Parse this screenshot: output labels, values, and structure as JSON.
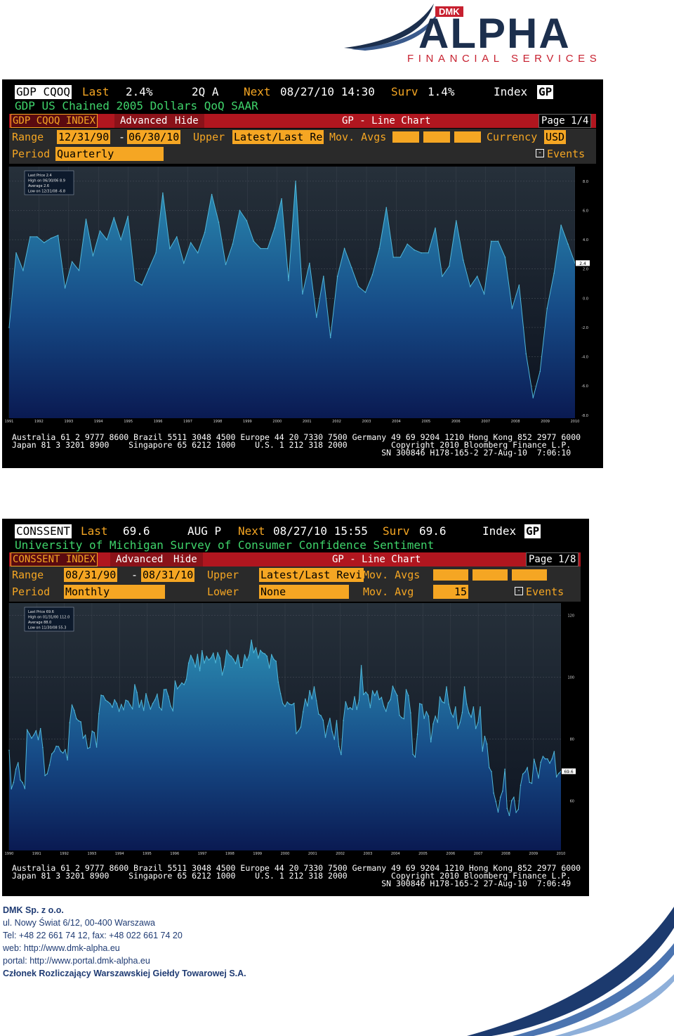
{
  "brand": {
    "badge": "DMK",
    "name": "ALPHA",
    "tagline": "FINANCIAL SERVICES",
    "colors": {
      "navy": "#1c2f4d",
      "red": "#c7202f",
      "terminal_orange": "#f5a623",
      "menu_red": "#b0161f"
    }
  },
  "terminals": [
    {
      "ticker": "GDP CQOQ",
      "last_label": "Last",
      "last_value": "2.4%",
      "period_code": "2Q A",
      "next_label": "Next",
      "next_datetime": "08/27/10 14:30",
      "surv_label": "Surv",
      "surv_value": "1.4%",
      "index_label": "Index",
      "gp_label": "GP",
      "description": "GDP US Chained 2005 Dollars QoQ SAAR",
      "menu": {
        "security": "GDP CQOQ INDEX",
        "advanced": "Advanced",
        "hide": "Hide",
        "title": "GP - Line Chart",
        "page": "Page 1/4"
      },
      "options": {
        "range_label": "Range",
        "range_start": "12/31/90",
        "dash": "-",
        "range_end": "06/30/10",
        "upper_label": "Upper",
        "upper_value": "Latest/Last Re",
        "movavg_label": "Mov. Avgs",
        "currency_label": "Currency",
        "currency_value": "USD",
        "period_label": "Period",
        "period_value": "Quarterly",
        "events_label": "Events"
      },
      "legend": [
        "Last Price  2.4",
        "High on 06/30/06  8.9",
        "Average  2.6",
        "Low on 12/31/08  -6.8"
      ],
      "footer": [
        "Australia 61 2 9777 8600 Brazil 5511 3048 4500 Europe 44 20 7330 7500 Germany 49 69 9204 1210 Hong Kong 852 2977 6000",
        "Japan 81 3 3201 8900    Singapore 65 6212 1000    U.S. 1 212 318 2000         Copyright 2010 Bloomberg Finance L.P.",
        "                                                                            SN 300846 H178-165-2 27-Aug-10  7:06:10"
      ]
    },
    {
      "ticker": "CONSSENT",
      "last_label": "Last",
      "last_value": "69.6",
      "period_code": "AUG P",
      "next_label": "Next",
      "next_datetime": "08/27/10 15:55",
      "surv_label": "Surv",
      "surv_value": "69.6",
      "index_label": "Index",
      "gp_label": "GP",
      "description": "University of Michigan Survey of Consumer Confidence Sentiment",
      "menu": {
        "security": "CONSSENT INDEX",
        "advanced": "Advanced",
        "hide": "Hide",
        "title": "GP - Line Chart",
        "page": "Page 1/8"
      },
      "options": {
        "range_label": "Range",
        "range_start": "08/31/90",
        "dash": "-",
        "range_end": "08/31/10",
        "upper_label": "Upper",
        "upper_value": "Latest/Last Revi",
        "movavg_label": "Mov. Avgs",
        "period_label": "Period",
        "period_value": "Monthly",
        "lower_label": "Lower",
        "lower_value": "None",
        "movavg2_label": "Mov. Avg",
        "movavg2_value": "15",
        "events_label": "Events"
      },
      "legend": [
        "Last Price  69.6",
        "High on 01/31/00  112.0",
        "Average  88.0",
        "Low on 11/30/08  55.3"
      ],
      "footer": [
        "Australia 61 2 9777 8600 Brazil 5511 3048 4500 Europe 44 20 7330 7500 Germany 49 69 9204 1210 Hong Kong 852 2977 6000",
        "Japan 81 3 3201 8900    Singapore 65 6212 1000    U.S. 1 212 318 2000         Copyright 2010 Bloomberg Finance L.P.",
        "                                                                            SN 300846 H178-165-2 27-Aug-10  7:06:49"
      ]
    }
  ],
  "chart_data": [
    {
      "type": "area",
      "title": "GDP US Chained 2005 Dollars QoQ SAAR",
      "x_start": "1991 Q1",
      "x_end": "2010 Q2",
      "x_step": "quarter",
      "x_ticks": [
        "1991",
        "1992",
        "1993",
        "1994",
        "1995",
        "1996",
        "1997",
        "1998",
        "1999",
        "2000",
        "2001",
        "2002",
        "2003",
        "2004",
        "2005",
        "2006",
        "2007",
        "2008",
        "2009",
        "2010"
      ],
      "y_ticks": [
        8.0,
        6.0,
        4.0,
        2.0,
        0.0,
        -2.0,
        -4.0,
        -6.0,
        -8.0
      ],
      "ylim": [
        -8.2,
        9.0
      ],
      "series": [
        {
          "name": "GDP CQOQ",
          "values": [
            -2.0,
            3.1,
            1.9,
            4.2,
            4.2,
            3.8,
            4.1,
            4.3,
            0.7,
            2.5,
            1.9,
            5.4,
            2.9,
            4.6,
            4.0,
            5.5,
            4.0,
            5.6,
            1.2,
            0.9,
            2.0,
            3.1,
            7.2,
            3.4,
            4.2,
            2.4,
            3.8,
            3.1,
            4.5,
            7.1,
            5.2,
            2.3,
            3.7,
            6.0,
            5.3,
            3.9,
            3.4,
            3.4,
            4.8,
            6.8,
            1.2,
            8.0,
            0.3,
            2.4,
            -1.3,
            1.5,
            -2.7,
            1.5,
            3.4,
            2.1,
            0.8,
            0.4,
            1.6,
            3.4,
            6.2,
            2.8,
            2.8,
            3.7,
            3.3,
            3.1,
            3.1,
            4.8,
            1.5,
            2.2,
            5.3,
            2.6,
            0.8,
            1.5,
            0.3,
            3.9,
            3.9,
            2.8,
            -0.7,
            0.9,
            -3.8,
            -6.8,
            -5.0,
            -0.7,
            1.7,
            5.0,
            3.7,
            2.4
          ]
        }
      ]
    },
    {
      "type": "area",
      "title": "University of Michigan Survey of Consumer Confidence Sentiment",
      "x_start": "1990-08",
      "x_end": "2010-08",
      "x_step": "month",
      "x_ticks": [
        "1990",
        "1991",
        "1992",
        "1993",
        "1994",
        "1995",
        "1996",
        "1997",
        "1998",
        "1999",
        "2000",
        "2001",
        "2002",
        "2003",
        "2004",
        "2005",
        "2006",
        "2007",
        "2008",
        "2009",
        "2010"
      ],
      "y_ticks": [
        120,
        100,
        80,
        60
      ],
      "ylim": [
        44,
        124
      ],
      "series": [
        {
          "name": "CONSSENT",
          "values": [
            76.4,
            63.9,
            66.0,
            70.3,
            72.4,
            66.8,
            65.9,
            64.0,
            83.0,
            81.7,
            80.3,
            81.3,
            82.7,
            79.8,
            83.4,
            77.3,
            68.2,
            68.8,
            71.6,
            75.2,
            76.0,
            77.7,
            77.6,
            76.1,
            75.5,
            76.6,
            73.3,
            85.3,
            91.0,
            89.3,
            86.6,
            85.9,
            85.6,
            80.3,
            81.3,
            77.0,
            77.3,
            82.6,
            82.1,
            77.4,
            88.2,
            94.2,
            94.0,
            92.6,
            92.1,
            91.5,
            90.3,
            92.7,
            91.5,
            89.0,
            91.2,
            89.5,
            92.6,
            92.3,
            91.0,
            89.8,
            97.6,
            95.1,
            90.3,
            92.5,
            89.3,
            94.7,
            92.0,
            89.7,
            91.5,
            92.7,
            94.5,
            90.3,
            89.4,
            96.0,
            96.1,
            93.8,
            90.7,
            89.2,
            98.8,
            96.3,
            97.2,
            98.2,
            97.6,
            99.3,
            104.6,
            107.1,
            105.6,
            103.3,
            107.4,
            102.1,
            108.6,
            104.6,
            106.8,
            105.6,
            106.3,
            107.8,
            104.7,
            107.9,
            106.2,
            100.7,
            103.5,
            108.7,
            107.3,
            106.8,
            105.8,
            104.4,
            107.2,
            103.2,
            103.2,
            107.2,
            105.4,
            107.2,
            112.0,
            108.0,
            109.5,
            106.2,
            108.7,
            107.9,
            107.6,
            106.8,
            103.0,
            107.3,
            105.8,
            105.2,
            98.4,
            94.7,
            91.5,
            90.6,
            92.0,
            91.3,
            91.1,
            91.6,
            81.8,
            82.7,
            83.9,
            88.8,
            93.0,
            90.7,
            95.7,
            93.0,
            96.9,
            92.4,
            88.1,
            87.6,
            86.1,
            80.6,
            84.2,
            86.7,
            82.4,
            79.9,
            86.0,
            77.6,
            75.0,
            86.0,
            92.1,
            89.7,
            90.2,
            89.6,
            93.7,
            89.6,
            92.6,
            103.8,
            94.4,
            95.2,
            94.3,
            90.2,
            95.6,
            94.1,
            95.6,
            92.8,
            93.5,
            90.6,
            89.0,
            91.7,
            92.8,
            97.1,
            95.5,
            94.1,
            87.7,
            86.9,
            86.6,
            96.0,
            94.1,
            88.5,
            75.1,
            74.2,
            81.6,
            91.5,
            91.2,
            86.7,
            88.9,
            87.4,
            79.1,
            84.9,
            87.4,
            85.4,
            93.6,
            92.1,
            91.7,
            96.9,
            91.3,
            88.4,
            87.1,
            90.4,
            83.4,
            85.3,
            88.6,
            96.9,
            91.3,
            88.4,
            87.1,
            90.4,
            83.4,
            85.3,
            90.4,
            76.1,
            80.9,
            78.4,
            70.8,
            69.5,
            62.6,
            59.8,
            56.4,
            61.2,
            63.2,
            70.3,
            57.6,
            55.3,
            60.1,
            61.2,
            56.3,
            57.3,
            65.1,
            68.7,
            69.4,
            70.8,
            66.0,
            65.7,
            73.5,
            70.6,
            67.4,
            72.5,
            74.4,
            73.6,
            73.6,
            72.2,
            73.6,
            76.0,
            67.8,
            68.9,
            69.6
          ]
        }
      ]
    }
  ],
  "contact": {
    "company": "DMK Sp. z o.o.",
    "address": "ul. Nowy Świat 6/12, 00-400 Warszawa",
    "phone": "Tel: +48 22 661 74 12, fax: +48 022 661 74 20",
    "web": "web: http://www.dmk-alpha.eu",
    "portal": "portal: http://www.portal.dmk-alpha.eu",
    "membership": "Członek Rozliczający Warszawskiej Giełdy Towarowej S.A."
  }
}
